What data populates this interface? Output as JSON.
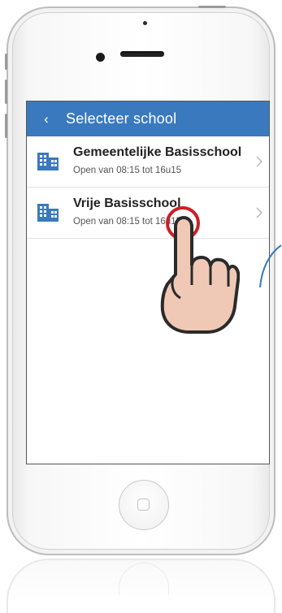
{
  "appbar": {
    "back_glyph": "‹",
    "title": "Selecteer school"
  },
  "schools": [
    {
      "name": "Gemeentelijke Basisschool",
      "hours": "Open van 08:15 tot 16u15",
      "icon": "building-icon"
    },
    {
      "name": "Vrije Basisschool",
      "hours": "Open van 08:15 tot 16u15",
      "icon": "building-icon"
    }
  ],
  "colors": {
    "accent": "#3a79be",
    "tap_marker": "#cc1f26",
    "hand_fill": "#f0c9b6"
  }
}
